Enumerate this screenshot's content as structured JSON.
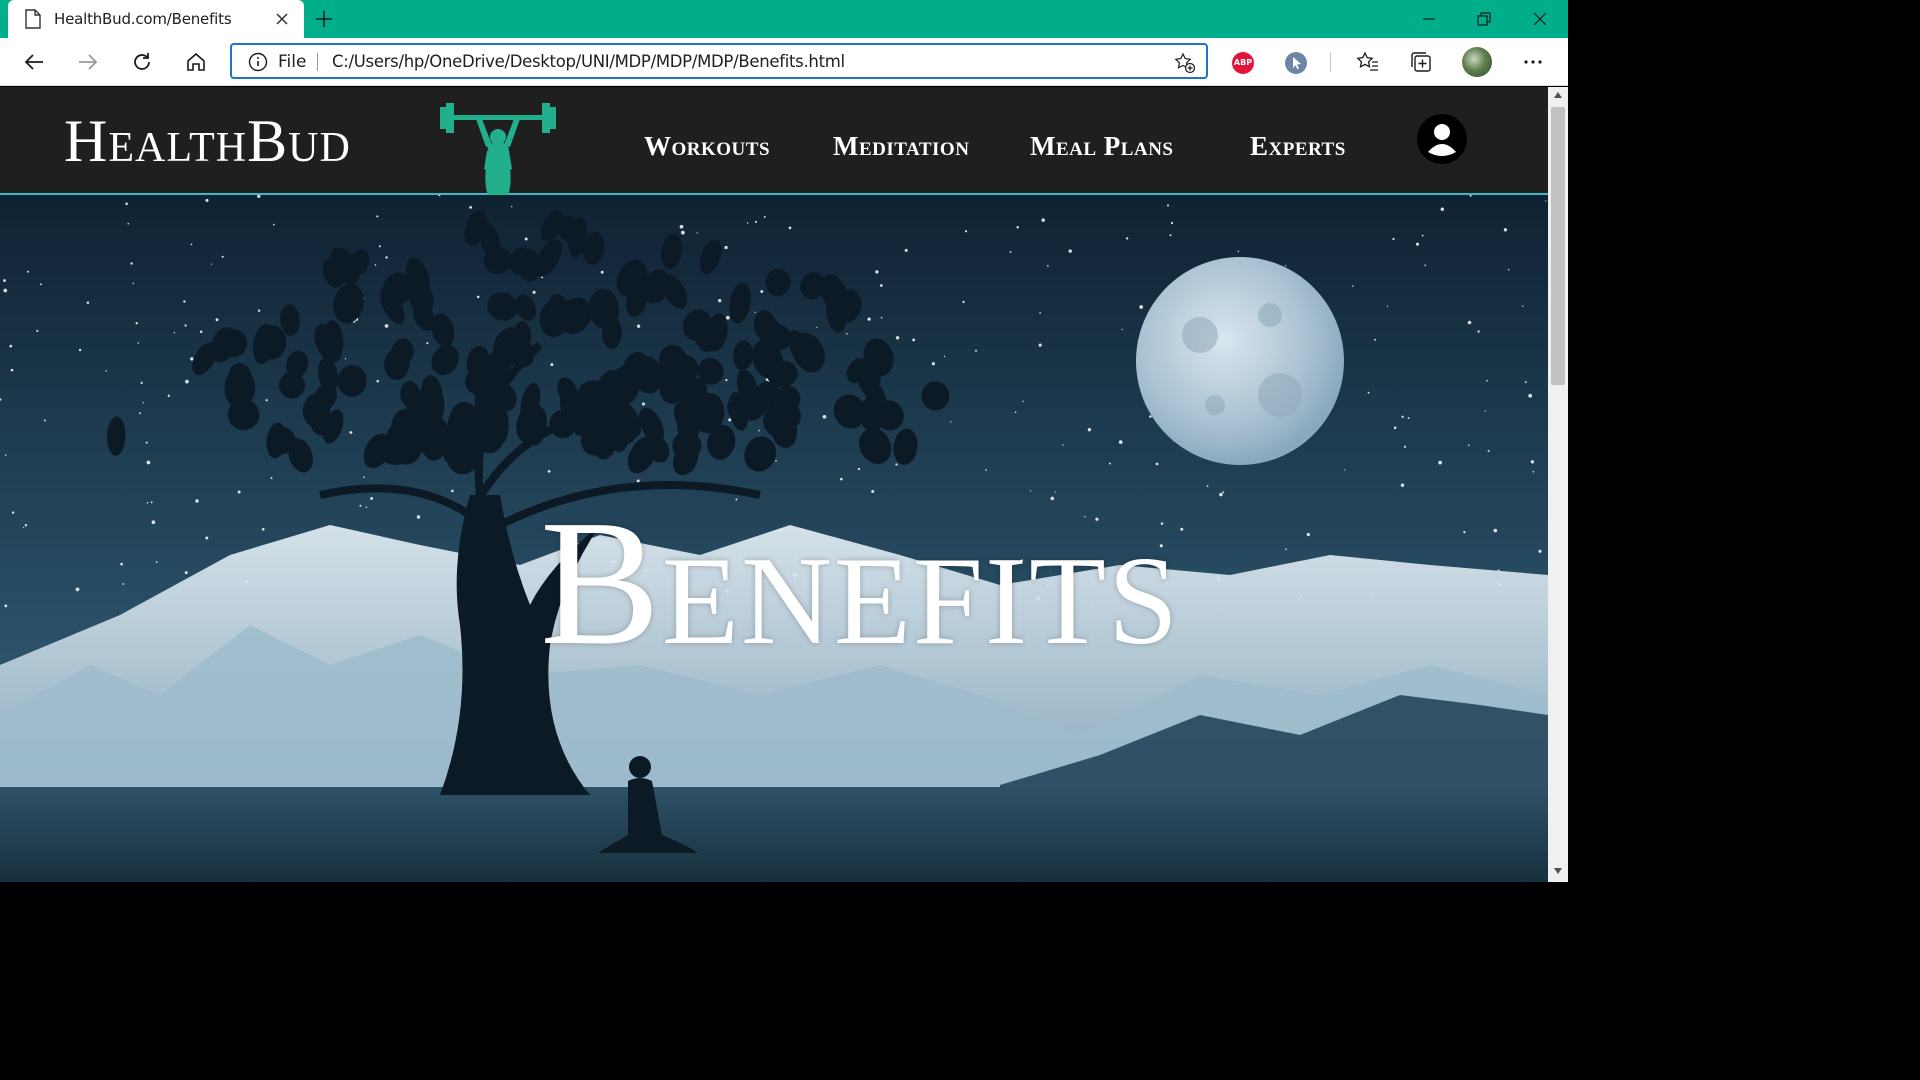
{
  "browser": {
    "tab_title": "HealthBud.com/Benefits",
    "address_label": "File",
    "url": "C:/Users/hp/OneDrive/Desktop/UNI/MDP/MDP/MDP/Benefits.html",
    "extension_abp_label": "ABP",
    "accent_color": "#00ae8c",
    "icons": [
      "page-icon",
      "close-icon",
      "plus-icon",
      "minimize-icon",
      "restore-icon",
      "close-window-icon",
      "back-icon",
      "forward-icon",
      "refresh-icon",
      "home-icon",
      "info-icon",
      "add-favorite-icon",
      "favorites-icon",
      "collections-icon",
      "more-icon"
    ]
  },
  "site": {
    "brand": "HealthBud",
    "nav": [
      {
        "label": "Workouts"
      },
      {
        "label": "Meditation"
      },
      {
        "label": "Meal Plans"
      },
      {
        "label": "Experts"
      }
    ],
    "account_icon": "user-circle-icon",
    "navbar_color": "#1f1f1f",
    "navbar_border_color": "#3cb8c4",
    "logo_color": "#22b08c"
  },
  "hero": {
    "title": "Benefits",
    "scene": "night-sky-tree-mountains-moon"
  }
}
